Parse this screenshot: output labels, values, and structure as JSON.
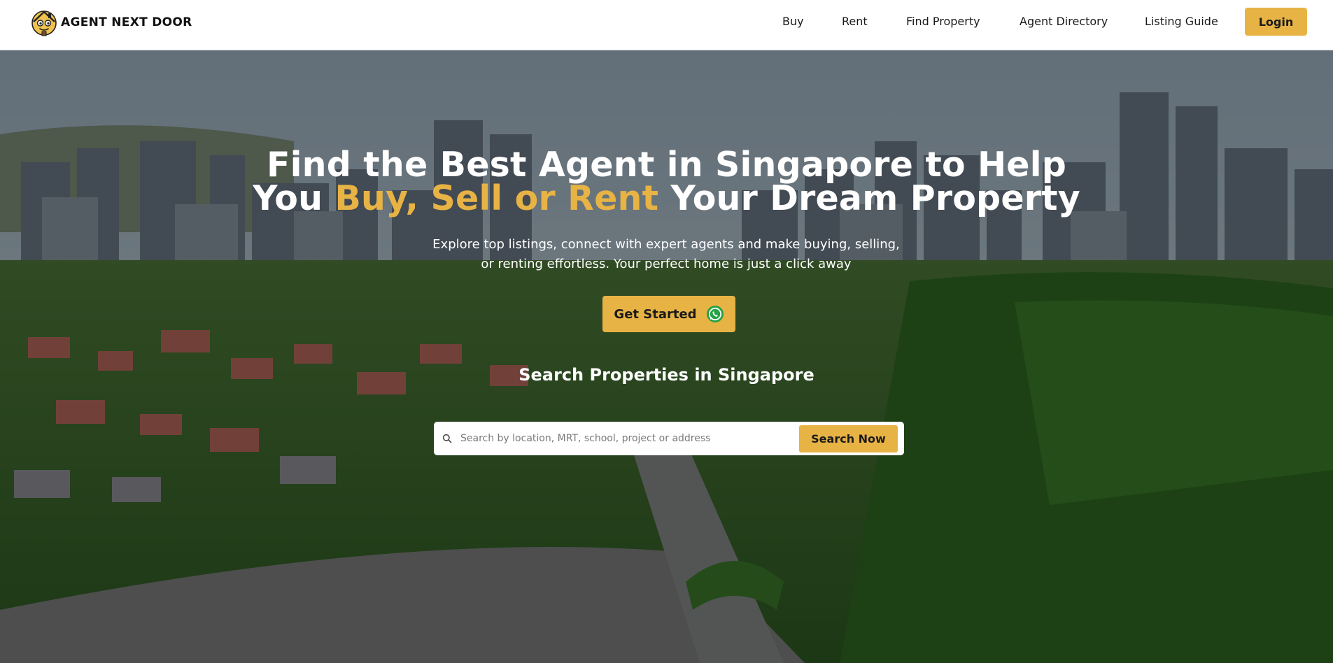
{
  "header": {
    "brand_name": "AGENT NEXT DOOR",
    "brand_icon": "house-mascot-logo",
    "nav": [
      "Buy",
      "Rent",
      "Find Property",
      "Agent Directory",
      "Listing Guide"
    ],
    "login_label": "Login"
  },
  "hero": {
    "headline_line1": "Find the Best Agent in Singapore to Help",
    "headline_line2_pre": "You ",
    "headline_line2_accent": "Buy, Sell or Rent",
    "headline_line2_post": " Your Dream Property",
    "subtitle_line1": "Explore top listings, connect with expert agents and make buying, selling,",
    "subtitle_line2": "or renting effortless. Your perfect home is just a click away",
    "cta_label": "Get Started",
    "cta_icon": "whatsapp-icon",
    "background": "aerial-city-photo"
  },
  "search": {
    "title": "Search Properties in Singapore",
    "placeholder": "Search by location, MRT, school, project or address",
    "button_label": "Search Now",
    "icon": "search-icon"
  },
  "colors": {
    "accent": "#e8b345",
    "header_bg": "#ffffff",
    "text_dark": "#1a1a1a",
    "hero_text": "#ffffff"
  }
}
